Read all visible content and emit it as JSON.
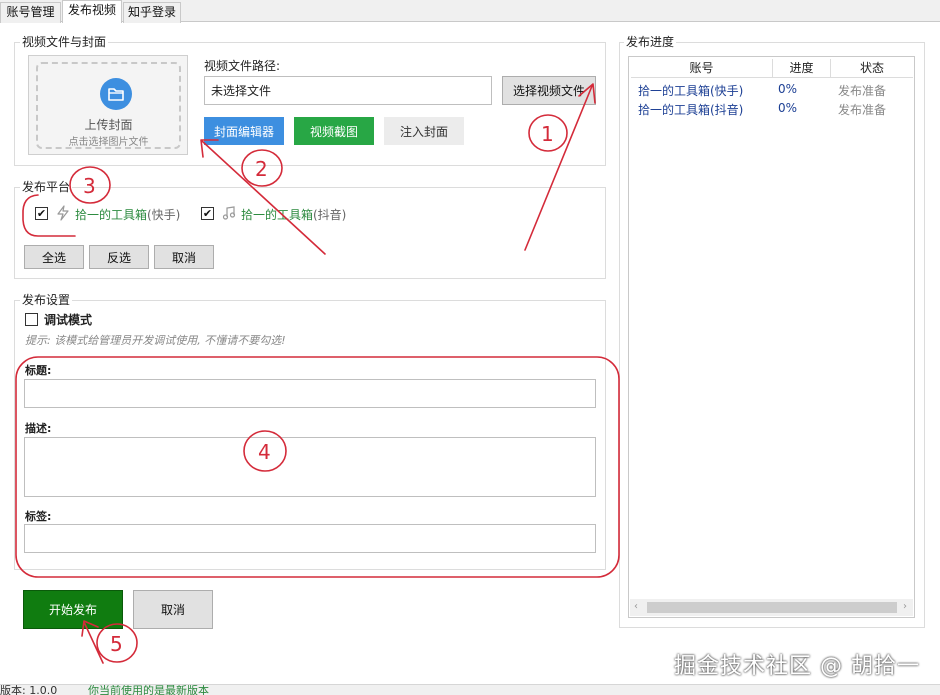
{
  "tabs": [
    {
      "label": "账号管理"
    },
    {
      "label": "发布视频"
    },
    {
      "label": "知乎登录"
    }
  ],
  "video_section": {
    "title": "视频文件与封面",
    "upload_title": "上传封面",
    "upload_hint": "点击选择图片文件",
    "path_label": "视频文件路径:",
    "path_value": "未选择文件",
    "choose_video": "选择视频文件",
    "cover_editor": "封面编辑器",
    "video_screenshot": "视频截图",
    "inject_cover": "注入封面"
  },
  "platform_section": {
    "title": "发布平台",
    "platforms": [
      {
        "label": "拾一的工具箱",
        "suffix": "(快手)",
        "checked": "✔"
      },
      {
        "label": "拾一的工具箱",
        "suffix": "(抖音)",
        "checked": "✔"
      }
    ],
    "select_all": "全选",
    "invert": "反选",
    "cancel": "取消"
  },
  "settings_section": {
    "title": "发布设置",
    "debug_label": "调试模式",
    "hint": "提示: 该模式给管理员开发调试使用, 不懂请不要勾选!",
    "title_label": "标题:",
    "desc_label": "描述:",
    "tags_label": "标签:"
  },
  "actions": {
    "start": "开始发布",
    "cancel": "取消"
  },
  "progress": {
    "title": "发布进度",
    "columns": [
      "账号",
      "进度",
      "状态"
    ],
    "rows": [
      {
        "account": "拾一的工具箱(快手)",
        "progress": "0%",
        "status": "发布准备"
      },
      {
        "account": "拾一的工具箱(抖音)",
        "progress": "0%",
        "status": "发布准备"
      }
    ]
  },
  "annotations": [
    "1",
    "2",
    "3",
    "4",
    "5"
  ],
  "watermark": "掘金技术社区 @ 胡拾一",
  "status_bar": {
    "version_label": "版本: 1.0.0",
    "message": "你当前使用的是最新版本"
  },
  "colors": {
    "blue_button": "#3d8fe0",
    "green_button": "#28a745",
    "start_button": "#107c10",
    "annotation": "#d42b3a",
    "account_text": "#1c3f94"
  }
}
